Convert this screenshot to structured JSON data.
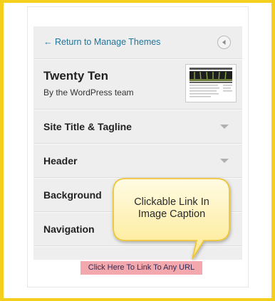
{
  "back": {
    "label": "← Return to Manage Themes"
  },
  "theme": {
    "name": "Twenty Ten",
    "author": "By the WordPress team"
  },
  "sections": [
    {
      "label": "Site Title & Tagline"
    },
    {
      "label": "Header"
    },
    {
      "label": "Background"
    },
    {
      "label": "Navigation"
    }
  ],
  "callout": {
    "line1": "Clickable Link In",
    "line2": "Image Caption"
  },
  "caption": {
    "text": "Click Here To Link To Any URL"
  },
  "colors": {
    "frame_border": "#f5cf1d",
    "link": "#21759b",
    "bubble_fill": "#fdf4b5",
    "bubble_border": "#f0c93a",
    "caption_bg": "#f2a8ad"
  },
  "icons": {
    "back": "circle-left-arrow-icon",
    "expand": "chevron-down-icon"
  }
}
